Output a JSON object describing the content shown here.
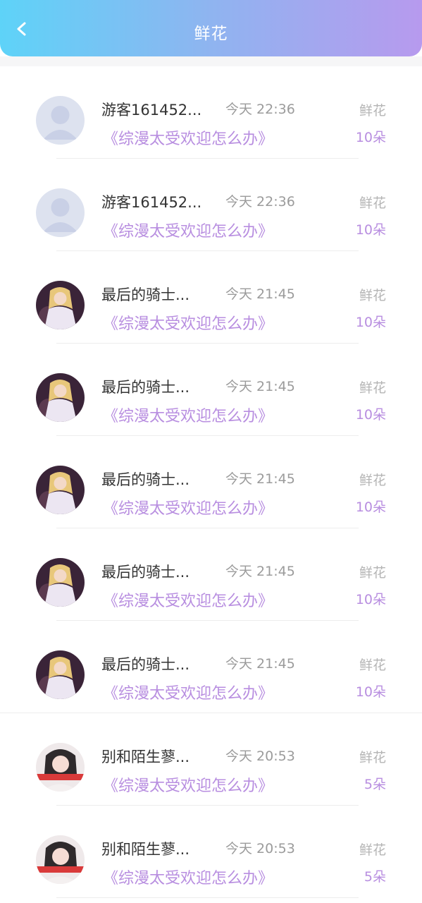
{
  "header": {
    "title": "鲜花"
  },
  "icons": {
    "back": "chevron-left-icon"
  },
  "colors": {
    "accent": "#b88ee0",
    "gradient_start": "#5ed3f8",
    "gradient_end": "#b79aee"
  },
  "records": [
    {
      "name": "游客161452...",
      "time": "今天 22:36",
      "book": "《综漫太受欢迎怎么办》",
      "gift": "鲜花",
      "count": "10朵",
      "avatar": "guest"
    },
    {
      "name": "游客161452...",
      "time": "今天 22:36",
      "book": "《综漫太受欢迎怎么办》",
      "gift": "鲜花",
      "count": "10朵",
      "avatar": "guest"
    },
    {
      "name": "最后的骑士...",
      "time": "今天 21:45",
      "book": "《综漫太受欢迎怎么办》",
      "gift": "鲜花",
      "count": "10朵",
      "avatar": "anime"
    },
    {
      "name": "最后的骑士...",
      "time": "今天 21:45",
      "book": "《综漫太受欢迎怎么办》",
      "gift": "鲜花",
      "count": "10朵",
      "avatar": "anime"
    },
    {
      "name": "最后的骑士...",
      "time": "今天 21:45",
      "book": "《综漫太受欢迎怎么办》",
      "gift": "鲜花",
      "count": "10朵",
      "avatar": "anime"
    },
    {
      "name": "最后的骑士...",
      "time": "今天 21:45",
      "book": "《综漫太受欢迎怎么办》",
      "gift": "鲜花",
      "count": "10朵",
      "avatar": "anime"
    },
    {
      "name": "最后的骑士...",
      "time": "今天 21:45",
      "book": "《综漫太受欢迎怎么办》",
      "gift": "鲜花",
      "count": "10朵",
      "avatar": "anime"
    },
    {
      "name": "别和陌生蓼...",
      "time": "今天 20:53",
      "book": "《综漫太受欢迎怎么办》",
      "gift": "鲜花",
      "count": "5朵",
      "avatar": "photo"
    },
    {
      "name": "别和陌生蓼...",
      "time": "今天 20:53",
      "book": "《综漫太受欢迎怎么办》",
      "gift": "鲜花",
      "count": "5朵",
      "avatar": "photo"
    }
  ]
}
